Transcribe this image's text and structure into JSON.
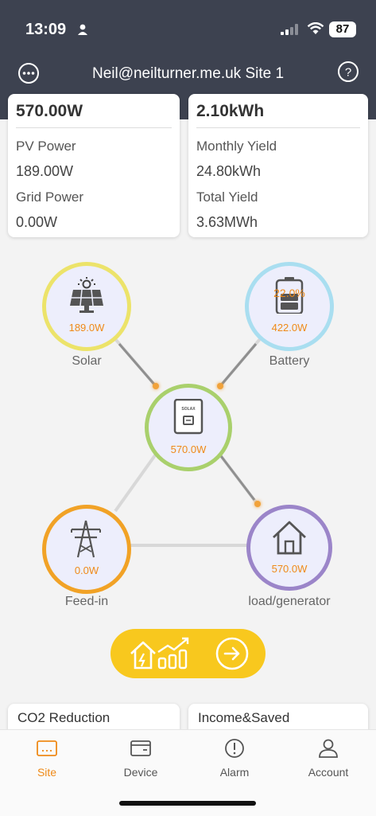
{
  "status_bar": {
    "time": "13:09",
    "battery": "87"
  },
  "header": {
    "title": "Neil@neilturner.me.uk Site 1"
  },
  "cards": {
    "left": {
      "main_value": "570.00W",
      "label1": "PV Power",
      "value1": "189.00W",
      "label2": "Grid Power",
      "value2": "0.00W"
    },
    "right": {
      "main_value": "2.10kWh",
      "label1": "Monthly Yield",
      "value1": "24.80kWh",
      "label2": "Total Yield",
      "value2": "3.63MWh"
    }
  },
  "flow": {
    "solar": {
      "value": "189.0W",
      "label": "Solar",
      "color": "#ece36a"
    },
    "battery": {
      "soc": "22.0%",
      "value": "422.0W",
      "label": "Battery",
      "color": "#a9def0"
    },
    "inverter": {
      "value": "570.0W",
      "brand": "SOLAX",
      "color": "#a9d06c"
    },
    "feed_in": {
      "value": "0.0W",
      "label": "Feed-in",
      "color": "#f1a226"
    },
    "load": {
      "value": "570.0W",
      "label": "load/generator",
      "color": "#9b85c9"
    }
  },
  "bottom_cards": {
    "left": "CO2 Reduction",
    "right": "Income&Saved"
  },
  "tabs": [
    {
      "label": "Site",
      "icon": "site-icon",
      "active": true
    },
    {
      "label": "Device",
      "icon": "device-icon",
      "active": false
    },
    {
      "label": "Alarm",
      "icon": "alarm-icon",
      "active": false
    },
    {
      "label": "Account",
      "icon": "account-icon",
      "active": false
    }
  ],
  "colors": {
    "accent": "#ef8a18",
    "header_bg": "#3d4250",
    "cta": "#f8c81e"
  }
}
